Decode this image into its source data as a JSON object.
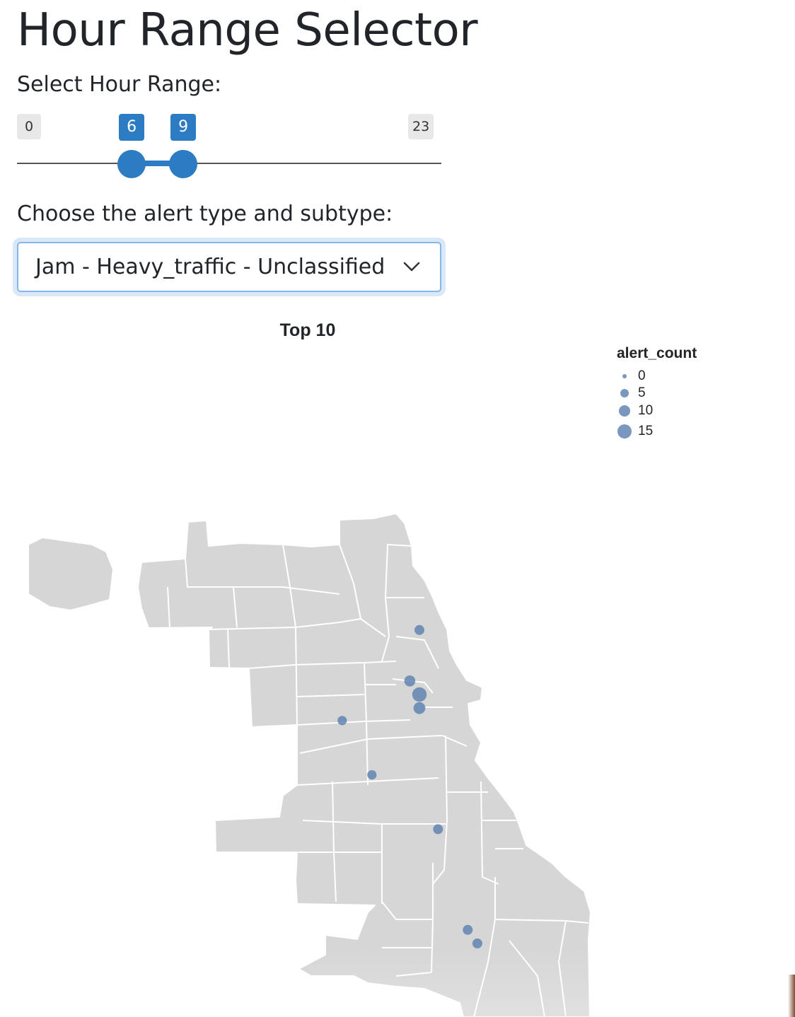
{
  "page": {
    "title": "Hour Range Selector"
  },
  "hour_slider": {
    "label": "Select Hour Range:",
    "min_label": "0",
    "max_label": "23",
    "min": 0,
    "max": 23,
    "from": 6,
    "to": 9,
    "from_label": "6",
    "to_label": "9",
    "color": "#2c7bc3"
  },
  "alert_select": {
    "label": "Choose the alert type and subtype:",
    "value": "Jam - Heavy_traffic - Unclassified"
  },
  "chart_data": {
    "type": "scatter",
    "title": "Top 10",
    "size_field": "alert_count",
    "legend": {
      "title": "alert_count",
      "placement": "top-right",
      "entries": [
        {
          "label": "0",
          "value": 0
        },
        {
          "label": "5",
          "value": 5
        },
        {
          "label": "10",
          "value": 10
        },
        {
          "label": "15",
          "value": 15
        }
      ]
    },
    "point_color": "#5a7fae",
    "basemap_color": "#d6d6d6",
    "points": [
      {
        "lon": -87.641,
        "lat": 41.943,
        "alert_count": 5
      },
      {
        "lon": -87.654,
        "lat": 41.898,
        "alert_count": 7
      },
      {
        "lon": -87.641,
        "lat": 41.886,
        "alert_count": 16
      },
      {
        "lon": -87.641,
        "lat": 41.874,
        "alert_count": 9
      },
      {
        "lon": -87.745,
        "lat": 41.863,
        "alert_count": 4
      },
      {
        "lon": -87.705,
        "lat": 41.815,
        "alert_count": 4
      },
      {
        "lon": -87.616,
        "lat": 41.767,
        "alert_count": 5
      },
      {
        "lon": -87.576,
        "lat": 41.678,
        "alert_count": 5
      },
      {
        "lon": -87.563,
        "lat": 41.666,
        "alert_count": 5
      }
    ]
  }
}
